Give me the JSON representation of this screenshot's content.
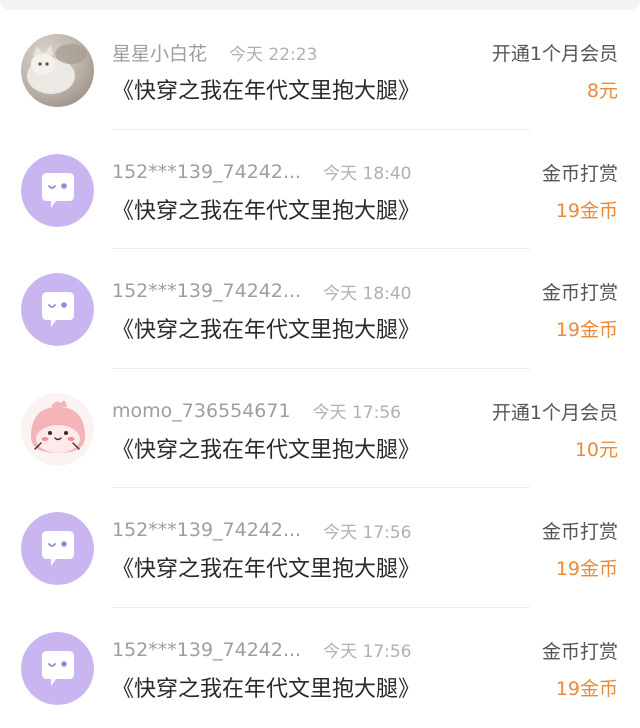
{
  "records": [
    {
      "username": "星星小白花",
      "time": "今天 22:23",
      "book_title": "《快穿之我在年代文里抱大腿》",
      "action": "开通1个月会员",
      "amount": "8元",
      "avatar": "cat-photo"
    },
    {
      "username": "152***139_74242...",
      "time": "今天 18:40",
      "book_title": "《快穿之我在年代文里抱大腿》",
      "action": "金币打赏",
      "amount": "19金币",
      "avatar": "default-chat-bubble"
    },
    {
      "username": "152***139_74242...",
      "time": "今天 18:40",
      "book_title": "《快穿之我在年代文里抱大腿》",
      "action": "金币打赏",
      "amount": "19金币",
      "avatar": "default-chat-bubble"
    },
    {
      "username": "momo_736554671",
      "time": "今天 17:56",
      "book_title": "《快穿之我在年代文里抱大腿》",
      "action": "开通1个月会员",
      "amount": "10元",
      "avatar": "pink-cartoon"
    },
    {
      "username": "152***139_74242...",
      "time": "今天 17:56",
      "book_title": "《快穿之我在年代文里抱大腿》",
      "action": "金币打赏",
      "amount": "19金币",
      "avatar": "default-chat-bubble"
    },
    {
      "username": "152***139_74242...",
      "time": "今天 17:56",
      "book_title": "《快穿之我在年代文里抱大腿》",
      "action": "金币打赏",
      "amount": "19金币",
      "avatar": "default-chat-bubble"
    }
  ],
  "colors": {
    "amount": "#e98a3a",
    "avatar_default_bg": "#c9b5f0",
    "avatar_default_bubble": "#ffffff"
  }
}
